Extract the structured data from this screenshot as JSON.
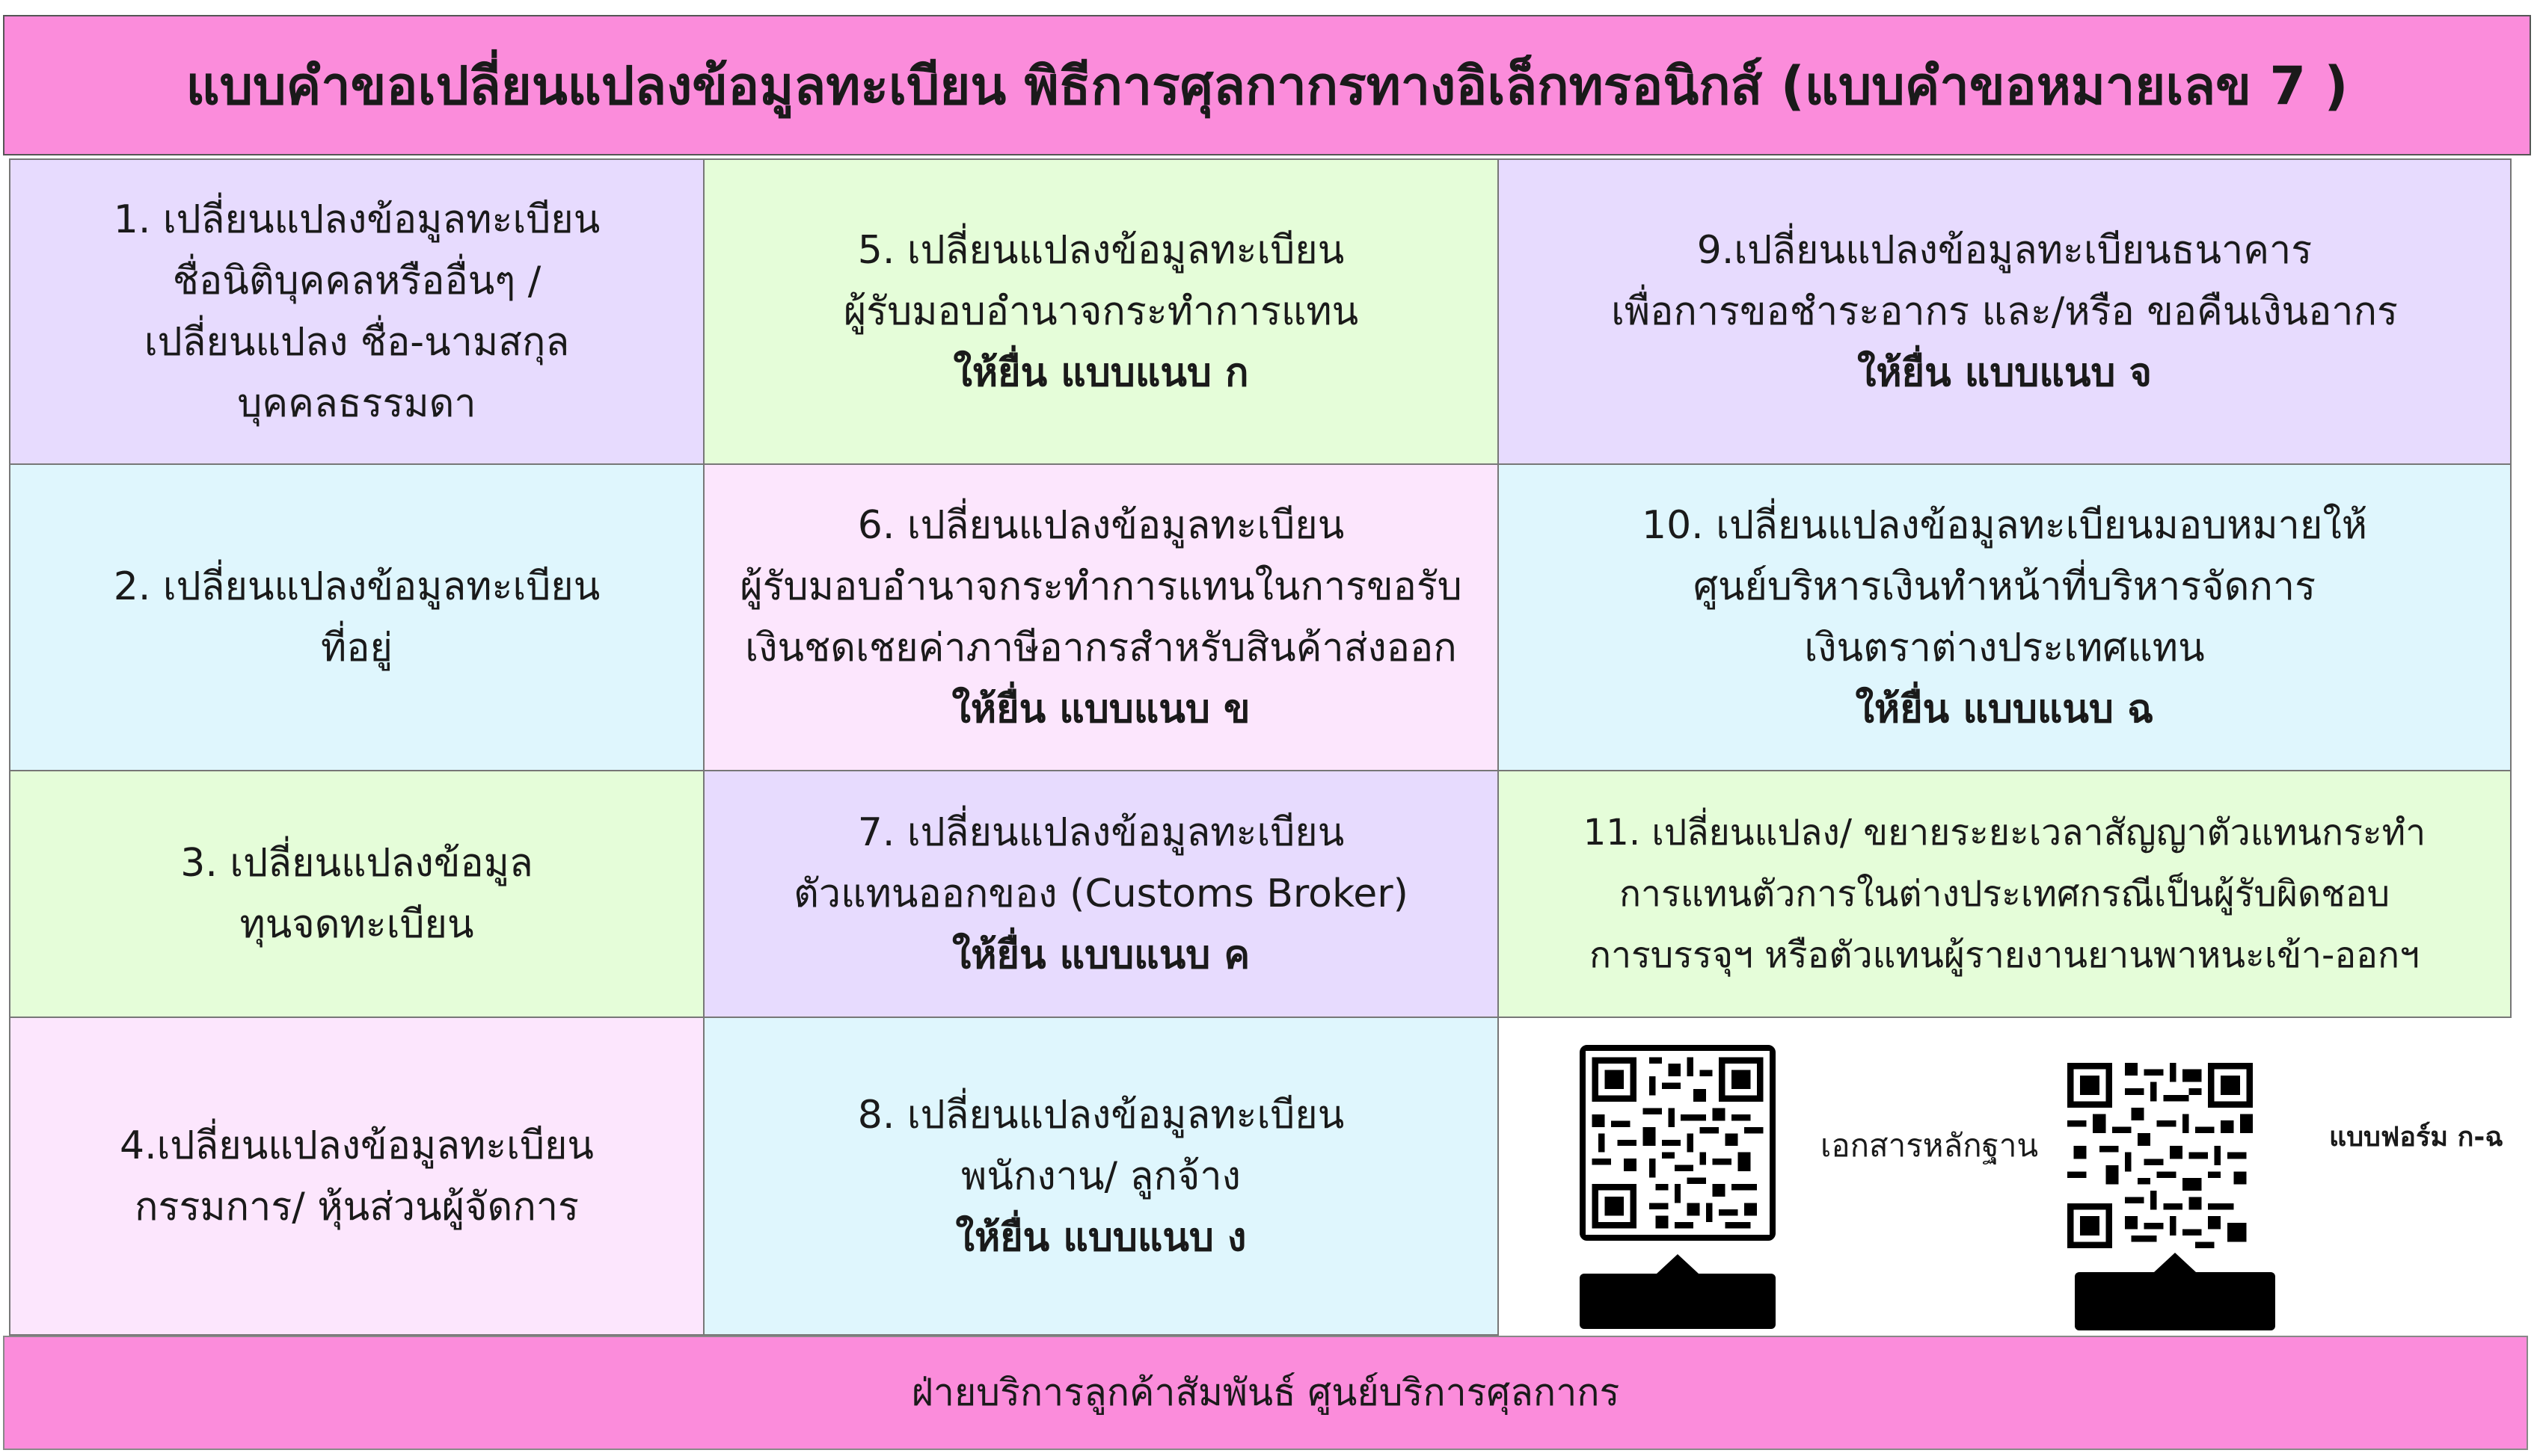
{
  "title": "แบบคำขอเปลี่ยนแปลงข้อมูลทะเบียน พิธีการศุลกากรทางอิเล็กทรอนิกส์ (แบบคำขอหมายเลข 7 )",
  "items": [
    {
      "lines": [
        "1. เปลี่ยนแปลงข้อมูลทะเบียน",
        "ชื่อนิติบุคคลหรืออื่นๆ /",
        "เปลี่ยนแปลง ชื่อ-นามสกุล",
        "บุคคลธรรมดา"
      ],
      "submit": ""
    },
    {
      "lines": [
        "2. เปลี่ยนแปลงข้อมูลทะเบียน",
        "ที่อยู่"
      ],
      "submit": ""
    },
    {
      "lines": [
        "3. เปลี่ยนแปลงข้อมูล",
        "ทุนจดทะเบียน"
      ],
      "submit": ""
    },
    {
      "lines": [
        "4.เปลี่ยนแปลงข้อมูลทะเบียน",
        "กรรมการ/ หุ้นส่วนผู้จัดการ"
      ],
      "submit": ""
    },
    {
      "lines": [
        "5. เปลี่ยนแปลงข้อมูลทะเบียน",
        "ผู้รับมอบอำนาจกระทำการแทน"
      ],
      "submit": "ให้ยื่น แบบแนบ ก"
    },
    {
      "lines": [
        "6. เปลี่ยนแปลงข้อมูลทะเบียน",
        "ผู้รับมอบอำนาจกระทำการแทนในการขอรับ",
        "เงินชดเชยค่าภาษีอากรสำหรับสินค้าส่งออก"
      ],
      "submit": "ให้ยื่น แบบแนบ ข"
    },
    {
      "lines": [
        "7. เปลี่ยนแปลงข้อมูลทะเบียน",
        "ตัวแทนออกของ (Customs Broker)"
      ],
      "submit": "ให้ยื่น แบบแนบ ค"
    },
    {
      "lines": [
        "8. เปลี่ยนแปลงข้อมูลทะเบียน",
        "พนักงาน/ ลูกจ้าง"
      ],
      "submit": "ให้ยื่น แบบแนบ ง"
    },
    {
      "lines": [
        "9.เปลี่ยนแปลงข้อมูลทะเบียนธนาคาร",
        "เพื่อการขอชำระอากร และ/หรือ ขอคืนเงินอากร"
      ],
      "submit": "ให้ยื่น แบบแนบ จ"
    },
    {
      "lines": [
        "10. เปลี่ยนแปลงข้อมูลทะเบียนมอบหมายให้",
        "ศูนย์บริหารเงินทำหน้าที่บริหารจัดการ",
        "เงินตราต่างประเทศแทน"
      ],
      "submit": "ให้ยื่น แบบแนบ ฉ"
    },
    {
      "lines": [
        "11. เปลี่ยนแปลง/ ขยายระยะเวลาสัญญาตัวแทนกระทำ",
        "การแทนตัวการในต่างประเทศกรณีเป็นผู้รับผิดชอบ",
        "การบรรจุฯ หรือตัวแทนผู้รายงานยานพาหนะเข้า-ออกฯ"
      ],
      "submit": ""
    }
  ],
  "qr": {
    "documents_label": "เอกสารหลักฐาน",
    "forms_label": "แบบฟอร์ม ก-ฉ"
  },
  "footer": "ฝ่ายบริการลูกค้าสัมพันธ์ ศูนย์บริการศุลกากร",
  "colors": {
    "header_footer": "#fb8cdb",
    "lavender": "#e7dbfe",
    "lime": "#e5fdd9",
    "sky": "#dff6fd",
    "pink": "#fce6fd"
  }
}
